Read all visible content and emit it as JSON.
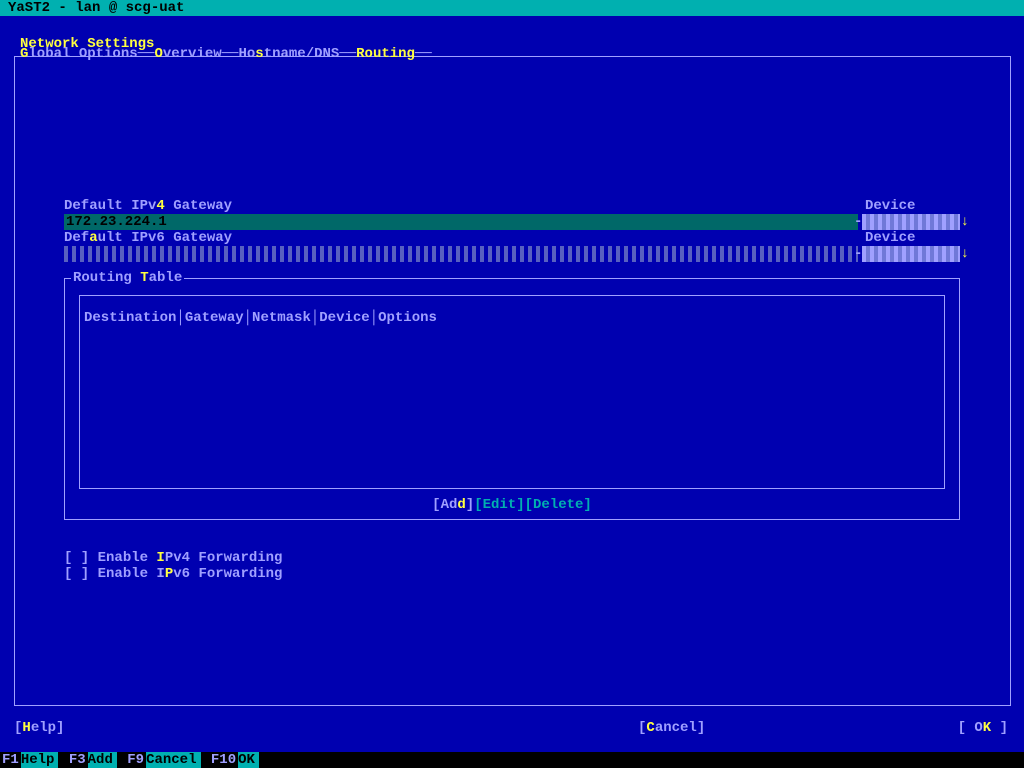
{
  "title_bar": "YaST2 - lan @ scg-uat",
  "section_title": "Network Settings",
  "tabs": {
    "global": {
      "pre": "G",
      "rest": "lobal Options"
    },
    "overview": {
      "pre": "O",
      "rest": "verview"
    },
    "hostname": {
      "pre": "Ho",
      "accel": "s",
      "rest": "tname/DNS"
    },
    "routing": {
      "pre": "R",
      "accel": "o",
      "rest": "uting"
    }
  },
  "ipv4_gateway": {
    "label_pre": "Default IPv",
    "accel": "4",
    "label_post": " Gateway",
    "value": "172.23.224.1"
  },
  "ipv6_gateway": {
    "label_pre": "Def",
    "accel": "a",
    "label_post": "ult IPv6 Gateway",
    "value": ""
  },
  "device_label": "Device",
  "device1_value": "-",
  "device2_value": "-",
  "routing_frame": {
    "title_pre": "Routing ",
    "accel": "T",
    "title_post": "able"
  },
  "table_headers": [
    "Destination",
    "Gateway",
    "Netmask",
    "Device",
    "Options"
  ],
  "buttons": {
    "add": {
      "bracket_open": "[",
      "pre": "Ad",
      "accel": "d",
      "bracket_close": "]"
    },
    "edit": {
      "text": "[Edit]"
    },
    "delete": {
      "text": "[Delete]"
    },
    "help": {
      "open": "[",
      "accel": "H",
      "rest": "elp]"
    },
    "cancel": {
      "open": "[",
      "accel": "C",
      "rest": "ancel]"
    },
    "ok": {
      "open": "[ O",
      "accel": "K",
      "close": " ]"
    }
  },
  "checkboxes": {
    "ipv4f": {
      "box": "[ ] ",
      "pre": "Enable ",
      "accel": "I",
      "post": "Pv4 Forwarding"
    },
    "ipv6f": {
      "box": "[ ] ",
      "pre": "Enable I",
      "accel": "P",
      "post": "v6 Forwarding"
    }
  },
  "fkeys": {
    "f1": {
      "key": "F1",
      "name": "Help"
    },
    "f3": {
      "key": "F3",
      "name": "Add"
    },
    "f9": {
      "key": "F9",
      "name": "Cancel"
    },
    "f10": {
      "key": "F10",
      "name": "OK"
    }
  }
}
